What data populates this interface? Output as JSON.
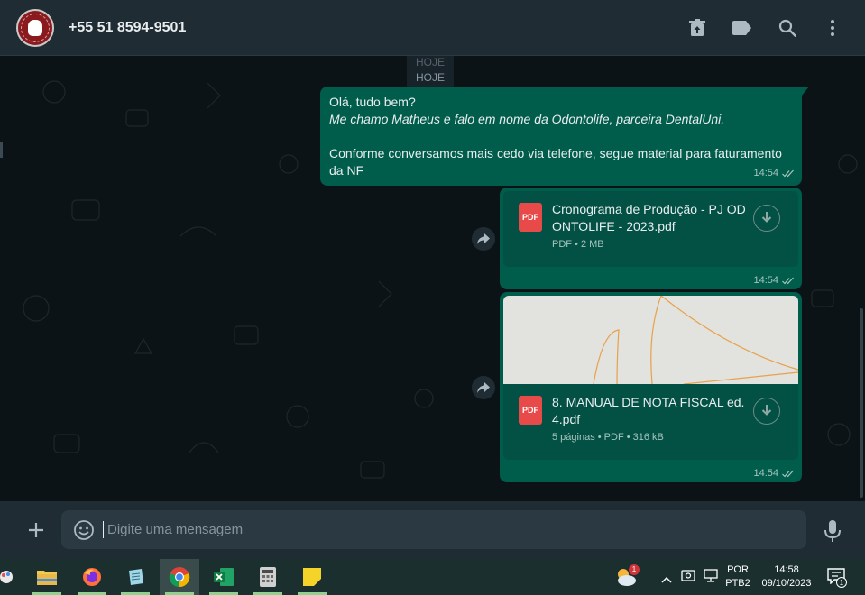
{
  "header": {
    "contact_name": "+55 51 8594-9501",
    "avatar_label": "OdontoLife",
    "icons": [
      "archive-icon",
      "label-icon",
      "search-icon",
      "more-icon"
    ]
  },
  "chat": {
    "date_separator": "HOJE",
    "date_separator_ghost": "HOJE",
    "message1": {
      "line1": "Olá, tudo bem?",
      "line2": "Me chamo Matheus e falo em nome da Odontolife, parceira DentalUni.",
      "line3": "Conforme conversamos mais cedo via telefone, segue material para faturamento da NF",
      "time": "14:54"
    },
    "doc1": {
      "badge": "PDF",
      "title": "Cronograma de Produção - PJ ODONTOLIFE - 2023.pdf",
      "meta": "PDF • 2 MB",
      "time": "14:54"
    },
    "doc2": {
      "badge": "PDF",
      "title": "8. MANUAL DE NOTA FISCAL ed. 4.pdf",
      "meta": "5 páginas • PDF • 316 kB",
      "time": "14:54"
    }
  },
  "composer": {
    "placeholder": "Digite uma mensagem"
  },
  "taskbar": {
    "lang_top": "POR",
    "lang_bottom": "PTB2",
    "clock_time": "14:58",
    "clock_date": "09/10/2023",
    "notification_count": "1",
    "weather_badge": "1"
  },
  "colors": {
    "bubble_out": "#005c4b",
    "header_bg": "#202c33",
    "chat_bg": "#0c1317",
    "accent": "#00a884"
  }
}
